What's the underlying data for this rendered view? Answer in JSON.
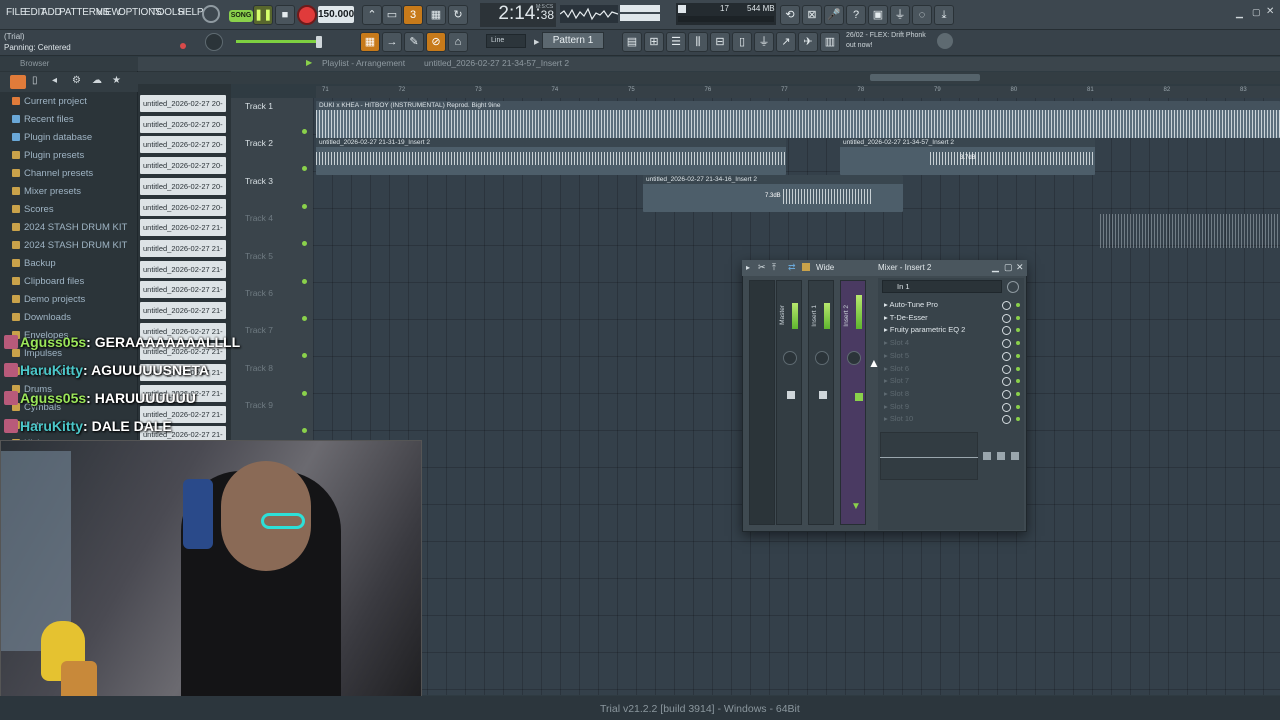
{
  "menu": [
    "FILE",
    "EDIT",
    "ADD",
    "PATTERNS",
    "VIEW",
    "OPTIONS",
    "TOOLS",
    "HELP"
  ],
  "transport": {
    "song_mode": "SONG",
    "tempo": "150.000",
    "time": "2:14",
    "time_small": "38",
    "time_unit": "M:S:CS",
    "cpu": "17",
    "memory": "544 MB"
  },
  "hint": {
    "line1": "(Trial)",
    "line2": "Panning: Centered"
  },
  "toolbar2": {
    "snap": "Line",
    "pattern": "Pattern 1"
  },
  "news": {
    "line1": "26/02 - FLEX: Drift Phonk",
    "line2": "out now!"
  },
  "browser": {
    "header": "Browser",
    "items": [
      {
        "label": "Current project",
        "color": "#e07b3a"
      },
      {
        "label": "Recent files",
        "color": "#6aa8d8"
      },
      {
        "label": "Plugin database",
        "color": "#6aa8d8"
      },
      {
        "label": "Plugin presets",
        "color": "#c9a24a"
      },
      {
        "label": "Channel presets",
        "color": "#c9a24a"
      },
      {
        "label": "Mixer presets",
        "color": "#c9a24a"
      },
      {
        "label": "Scores",
        "color": "#c9a24a"
      },
      {
        "label": "2024 STASH DRUM KIT",
        "color": "#c9a24a"
      },
      {
        "label": "2024 STASH DRUM KIT",
        "color": "#c9a24a"
      },
      {
        "label": "Backup",
        "color": "#c9a24a"
      },
      {
        "label": "Clipboard files",
        "color": "#c9a24a"
      },
      {
        "label": "Demo projects",
        "color": "#c9a24a"
      },
      {
        "label": "Downloads",
        "color": "#c9a24a"
      },
      {
        "label": "Envelopes",
        "color": "#c9a24a"
      },
      {
        "label": "Impulses",
        "color": "#c9a24a"
      },
      {
        "label": "My projects",
        "color": "#c9a24a"
      },
      {
        "label": "Drums",
        "color": "#c9a24a"
      },
      {
        "label": "Cymbals",
        "color": "#c9a24a"
      },
      {
        "label": "Hats",
        "color": "#c9a24a"
      },
      {
        "label": "Kicks",
        "color": "#c9a24a"
      }
    ]
  },
  "clips_list": [
    "untitled_2026-02-27 20-",
    "untitled_2026-02-27 20-",
    "untitled_2026-02-27 20-",
    "untitled_2026-02-27 20-",
    "untitled_2026-02-27 20-",
    "untitled_2026-02-27 20-",
    "untitled_2026-02-27 21-",
    "untitled_2026-02-27 21-",
    "untitled_2026-02-27 21-",
    "untitled_2026-02-27 21-",
    "untitled_2026-02-27 21-",
    "untitled_2026-02-27 21-",
    "untitled_2026-02-27 21-",
    "untitled_2026-02-27 21-",
    "untitled_2026-02-27 21-",
    "untitled_2026-02-27 21-",
    "untitled_2026-02-27 21-"
  ],
  "playlist": {
    "title": "Playlist - Arrangement",
    "file": "untitled_2026-02-27 21-34-57_Insert 2",
    "ruler": [
      "71",
      "72",
      "73",
      "74",
      "75",
      "76",
      "77",
      "78",
      "79",
      "80",
      "81",
      "82",
      "83"
    ],
    "tracks": [
      "Track 1",
      "Track 2",
      "Track 3",
      "Track 4",
      "Track 5",
      "Track 6",
      "Track 7",
      "Track 8",
      "Track 9"
    ],
    "clips": [
      {
        "label": "DUKI x KHEA - HITBOY (INSTRUMENTAL) Reprod. Bight 9ine"
      },
      {
        "label": "untitled_2026-02-27 21-31-19_Insert 2"
      },
      {
        "label": "untitled_2026-02-27 21-34-57_Insert 2",
        "gain": "3.7dB"
      },
      {
        "label": "untitled_2026-02-27 21-34-16_Insert 2",
        "gain": "7.3dB"
      }
    ]
  },
  "mixer": {
    "preset": "Wide",
    "title": "Mixer - Insert 2",
    "strips": [
      "Master",
      "Insert 1",
      "Insert 2"
    ],
    "strip_numbers": [
      "C",
      "M",
      "1",
      "2"
    ],
    "input": "In 1",
    "slots": [
      {
        "label": "Auto-Tune Pro",
        "empty": false
      },
      {
        "label": "T-De-Esser",
        "empty": false
      },
      {
        "label": "Fruity parametric EQ 2",
        "empty": false
      },
      {
        "label": "Slot 4",
        "empty": true
      },
      {
        "label": "Slot 5",
        "empty": true
      },
      {
        "label": "Slot 6",
        "empty": true
      },
      {
        "label": "Slot 7",
        "empty": true
      },
      {
        "label": "Slot 8",
        "empty": true
      },
      {
        "label": "Slot 9",
        "empty": true
      },
      {
        "label": "Slot 10",
        "empty": true
      }
    ]
  },
  "chat": [
    {
      "user": "Aguss05s",
      "message": "GERAAAAAAAALLLL",
      "user_color": "#9be65a"
    },
    {
      "user": "HaruKitty",
      "message": "AGUUUUUSNETA",
      "user_color": "#4bc7c9"
    },
    {
      "user": "Aguss05s",
      "message": "HARUUUUUUU",
      "user_color": "#9be65a"
    },
    {
      "user": "HaruKitty",
      "message": "DALE DALE",
      "user_color": "#4bc7c9"
    }
  ],
  "status": "Trial v21.2.2 [build 3914] - Windows - 64Bit"
}
